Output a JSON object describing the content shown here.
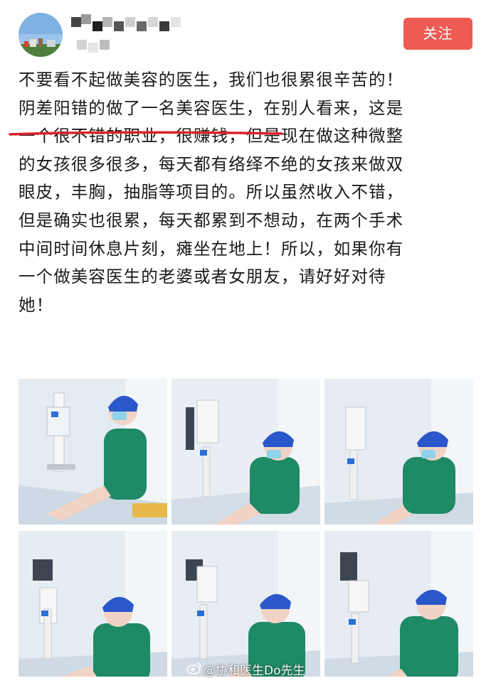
{
  "header": {
    "follow_label": "关注"
  },
  "post": {
    "lines": [
      "不要看不起做美容的医生，我们也很累很辛苦的！",
      "阴差阳错的做了一名美容医生，在别人看来，这是",
      "一个很不错的职业，很赚钱，但是现在做这种微整",
      "的女孩很多很多，每天都有络绎不绝的女孩来做双",
      "眼皮，丰胸，抽脂等项目的。所以虽然收入不错，",
      "但是确实也很累，每天都累到不想动，在两个手术",
      "中间时间休息片刻，瘫坐在地上！所以，如果你有",
      "一个做美容医生的老婆或者女朋友，请好好对待",
      "她！"
    ]
  },
  "watermark": {
    "text": "@协和医生Do先生"
  },
  "colors": {
    "follow_bg": "#ee5b52",
    "underline": "#d8232a",
    "scrub_green": "#1f8a66",
    "cap_blue": "#2a57c9",
    "mask_blue": "#8fd3ea"
  }
}
